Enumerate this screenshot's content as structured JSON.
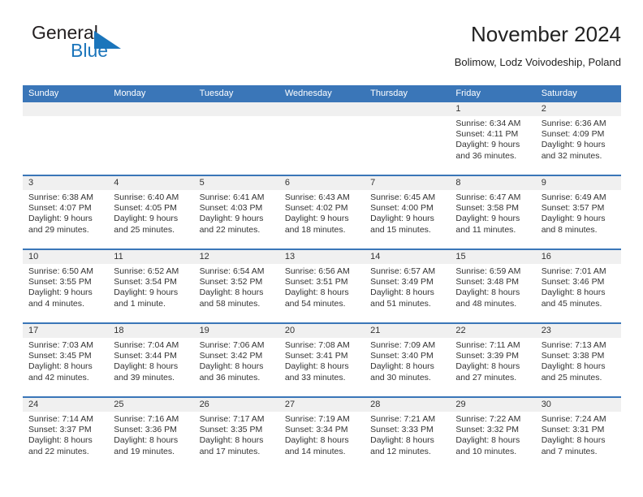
{
  "brand": {
    "name_part1": "General",
    "name_part2": "Blue",
    "mark_icon": "blue-triangle-flag-icon"
  },
  "header": {
    "title": "November 2024",
    "subtitle": "Bolimow, Lodz Voivodeship, Poland"
  },
  "colors": {
    "header_blue": "#3a76b8",
    "brand_blue": "#1b75bb",
    "date_strip_gray": "#f0f0f0",
    "text": "#333333"
  },
  "weekdays": [
    "Sunday",
    "Monday",
    "Tuesday",
    "Wednesday",
    "Thursday",
    "Friday",
    "Saturday"
  ],
  "weeks": [
    {
      "days": [
        {
          "date": "",
          "sunrise": "",
          "sunset": "",
          "daylight_a": "",
          "daylight_b": "",
          "empty": true
        },
        {
          "date": "",
          "sunrise": "",
          "sunset": "",
          "daylight_a": "",
          "daylight_b": "",
          "empty": true
        },
        {
          "date": "",
          "sunrise": "",
          "sunset": "",
          "daylight_a": "",
          "daylight_b": "",
          "empty": true
        },
        {
          "date": "",
          "sunrise": "",
          "sunset": "",
          "daylight_a": "",
          "daylight_b": "",
          "empty": true
        },
        {
          "date": "",
          "sunrise": "",
          "sunset": "",
          "daylight_a": "",
          "daylight_b": "",
          "empty": true
        },
        {
          "date": "1",
          "sunrise": "Sunrise: 6:34 AM",
          "sunset": "Sunset: 4:11 PM",
          "daylight_a": "Daylight: 9 hours",
          "daylight_b": "and 36 minutes.",
          "empty": false
        },
        {
          "date": "2",
          "sunrise": "Sunrise: 6:36 AM",
          "sunset": "Sunset: 4:09 PM",
          "daylight_a": "Daylight: 9 hours",
          "daylight_b": "and 32 minutes.",
          "empty": false
        }
      ]
    },
    {
      "days": [
        {
          "date": "3",
          "sunrise": "Sunrise: 6:38 AM",
          "sunset": "Sunset: 4:07 PM",
          "daylight_a": "Daylight: 9 hours",
          "daylight_b": "and 29 minutes.",
          "empty": false
        },
        {
          "date": "4",
          "sunrise": "Sunrise: 6:40 AM",
          "sunset": "Sunset: 4:05 PM",
          "daylight_a": "Daylight: 9 hours",
          "daylight_b": "and 25 minutes.",
          "empty": false
        },
        {
          "date": "5",
          "sunrise": "Sunrise: 6:41 AM",
          "sunset": "Sunset: 4:03 PM",
          "daylight_a": "Daylight: 9 hours",
          "daylight_b": "and 22 minutes.",
          "empty": false
        },
        {
          "date": "6",
          "sunrise": "Sunrise: 6:43 AM",
          "sunset": "Sunset: 4:02 PM",
          "daylight_a": "Daylight: 9 hours",
          "daylight_b": "and 18 minutes.",
          "empty": false
        },
        {
          "date": "7",
          "sunrise": "Sunrise: 6:45 AM",
          "sunset": "Sunset: 4:00 PM",
          "daylight_a": "Daylight: 9 hours",
          "daylight_b": "and 15 minutes.",
          "empty": false
        },
        {
          "date": "8",
          "sunrise": "Sunrise: 6:47 AM",
          "sunset": "Sunset: 3:58 PM",
          "daylight_a": "Daylight: 9 hours",
          "daylight_b": "and 11 minutes.",
          "empty": false
        },
        {
          "date": "9",
          "sunrise": "Sunrise: 6:49 AM",
          "sunset": "Sunset: 3:57 PM",
          "daylight_a": "Daylight: 9 hours",
          "daylight_b": "and 8 minutes.",
          "empty": false
        }
      ]
    },
    {
      "days": [
        {
          "date": "10",
          "sunrise": "Sunrise: 6:50 AM",
          "sunset": "Sunset: 3:55 PM",
          "daylight_a": "Daylight: 9 hours",
          "daylight_b": "and 4 minutes.",
          "empty": false
        },
        {
          "date": "11",
          "sunrise": "Sunrise: 6:52 AM",
          "sunset": "Sunset: 3:54 PM",
          "daylight_a": "Daylight: 9 hours",
          "daylight_b": "and 1 minute.",
          "empty": false
        },
        {
          "date": "12",
          "sunrise": "Sunrise: 6:54 AM",
          "sunset": "Sunset: 3:52 PM",
          "daylight_a": "Daylight: 8 hours",
          "daylight_b": "and 58 minutes.",
          "empty": false
        },
        {
          "date": "13",
          "sunrise": "Sunrise: 6:56 AM",
          "sunset": "Sunset: 3:51 PM",
          "daylight_a": "Daylight: 8 hours",
          "daylight_b": "and 54 minutes.",
          "empty": false
        },
        {
          "date": "14",
          "sunrise": "Sunrise: 6:57 AM",
          "sunset": "Sunset: 3:49 PM",
          "daylight_a": "Daylight: 8 hours",
          "daylight_b": "and 51 minutes.",
          "empty": false
        },
        {
          "date": "15",
          "sunrise": "Sunrise: 6:59 AM",
          "sunset": "Sunset: 3:48 PM",
          "daylight_a": "Daylight: 8 hours",
          "daylight_b": "and 48 minutes.",
          "empty": false
        },
        {
          "date": "16",
          "sunrise": "Sunrise: 7:01 AM",
          "sunset": "Sunset: 3:46 PM",
          "daylight_a": "Daylight: 8 hours",
          "daylight_b": "and 45 minutes.",
          "empty": false
        }
      ]
    },
    {
      "days": [
        {
          "date": "17",
          "sunrise": "Sunrise: 7:03 AM",
          "sunset": "Sunset: 3:45 PM",
          "daylight_a": "Daylight: 8 hours",
          "daylight_b": "and 42 minutes.",
          "empty": false
        },
        {
          "date": "18",
          "sunrise": "Sunrise: 7:04 AM",
          "sunset": "Sunset: 3:44 PM",
          "daylight_a": "Daylight: 8 hours",
          "daylight_b": "and 39 minutes.",
          "empty": false
        },
        {
          "date": "19",
          "sunrise": "Sunrise: 7:06 AM",
          "sunset": "Sunset: 3:42 PM",
          "daylight_a": "Daylight: 8 hours",
          "daylight_b": "and 36 minutes.",
          "empty": false
        },
        {
          "date": "20",
          "sunrise": "Sunrise: 7:08 AM",
          "sunset": "Sunset: 3:41 PM",
          "daylight_a": "Daylight: 8 hours",
          "daylight_b": "and 33 minutes.",
          "empty": false
        },
        {
          "date": "21",
          "sunrise": "Sunrise: 7:09 AM",
          "sunset": "Sunset: 3:40 PM",
          "daylight_a": "Daylight: 8 hours",
          "daylight_b": "and 30 minutes.",
          "empty": false
        },
        {
          "date": "22",
          "sunrise": "Sunrise: 7:11 AM",
          "sunset": "Sunset: 3:39 PM",
          "daylight_a": "Daylight: 8 hours",
          "daylight_b": "and 27 minutes.",
          "empty": false
        },
        {
          "date": "23",
          "sunrise": "Sunrise: 7:13 AM",
          "sunset": "Sunset: 3:38 PM",
          "daylight_a": "Daylight: 8 hours",
          "daylight_b": "and 25 minutes.",
          "empty": false
        }
      ]
    },
    {
      "days": [
        {
          "date": "24",
          "sunrise": "Sunrise: 7:14 AM",
          "sunset": "Sunset: 3:37 PM",
          "daylight_a": "Daylight: 8 hours",
          "daylight_b": "and 22 minutes.",
          "empty": false
        },
        {
          "date": "25",
          "sunrise": "Sunrise: 7:16 AM",
          "sunset": "Sunset: 3:36 PM",
          "daylight_a": "Daylight: 8 hours",
          "daylight_b": "and 19 minutes.",
          "empty": false
        },
        {
          "date": "26",
          "sunrise": "Sunrise: 7:17 AM",
          "sunset": "Sunset: 3:35 PM",
          "daylight_a": "Daylight: 8 hours",
          "daylight_b": "and 17 minutes.",
          "empty": false
        },
        {
          "date": "27",
          "sunrise": "Sunrise: 7:19 AM",
          "sunset": "Sunset: 3:34 PM",
          "daylight_a": "Daylight: 8 hours",
          "daylight_b": "and 14 minutes.",
          "empty": false
        },
        {
          "date": "28",
          "sunrise": "Sunrise: 7:21 AM",
          "sunset": "Sunset: 3:33 PM",
          "daylight_a": "Daylight: 8 hours",
          "daylight_b": "and 12 minutes.",
          "empty": false
        },
        {
          "date": "29",
          "sunrise": "Sunrise: 7:22 AM",
          "sunset": "Sunset: 3:32 PM",
          "daylight_a": "Daylight: 8 hours",
          "daylight_b": "and 10 minutes.",
          "empty": false
        },
        {
          "date": "30",
          "sunrise": "Sunrise: 7:24 AM",
          "sunset": "Sunset: 3:31 PM",
          "daylight_a": "Daylight: 8 hours",
          "daylight_b": "and 7 minutes.",
          "empty": false
        }
      ]
    }
  ]
}
